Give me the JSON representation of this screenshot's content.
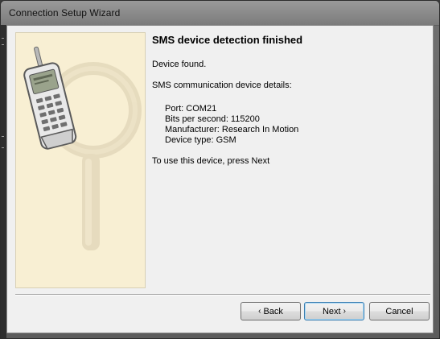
{
  "window": {
    "title": "Connection Setup Wizard"
  },
  "page": {
    "heading": "SMS device detection finished",
    "status": "Device found.",
    "details_label": "SMS communication device details:",
    "details": [
      "Port: COM21",
      "Bits per second: 115200",
      "Manufacturer: Research In Motion",
      "Device type: GSM"
    ],
    "instruction": "To use this device, press Next"
  },
  "buttons": {
    "back_arrow": "‹",
    "back_label": "Back",
    "next_label": "Next",
    "next_arrow": "›",
    "cancel_label": "Cancel"
  },
  "banner": {
    "illustration": [
      "magnifier-icon",
      "mobile-phone-icon"
    ]
  },
  "colors": {
    "banner_bg": "#f8efd3",
    "dialog_bg": "#f0f0f0",
    "default_button_border": "#3c7fb1"
  }
}
